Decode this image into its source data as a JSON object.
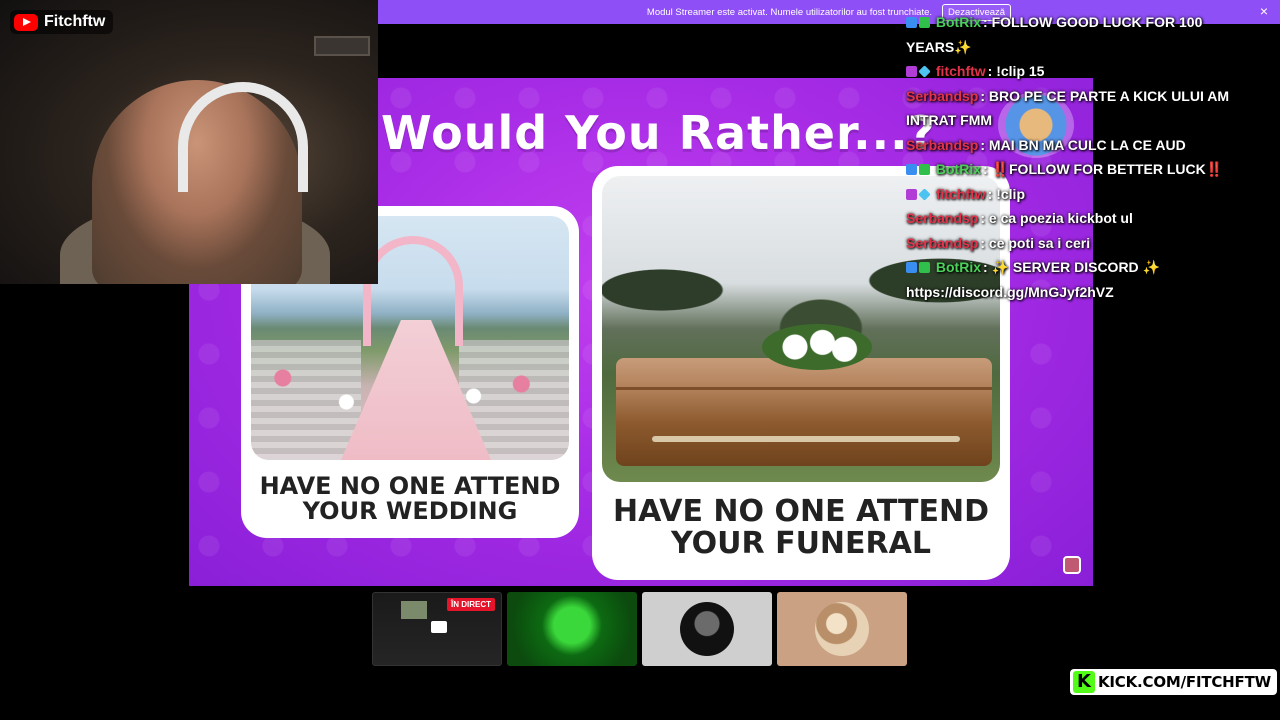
{
  "webcam": {
    "channel_name": "Fitchftw"
  },
  "banner": {
    "text": "Modul Streamer este activat. Numele utilizatorilor au fost trunchiate.",
    "button": "Dezactivează",
    "close": "×"
  },
  "quiz": {
    "title": "Would You Rather...?",
    "left_option": "HAVE NO ONE ATTEND YOUR WEDDING",
    "right_option": "HAVE NO ONE ATTEND YOUR FUNERAL"
  },
  "chat": {
    "messages": [
      {
        "user": "BotRix",
        "user_color": "#4bd15a",
        "text": "FOLLOW GOOD LUCK FOR 100 YEARS✨",
        "badges": [
          "bot-badge-icon",
          "verified-icon"
        ]
      },
      {
        "user": "fitchftw",
        "user_color": "#e3334a",
        "text": "!clip 15",
        "badges": [
          "mic-badge-icon",
          "cube-badge-icon"
        ]
      },
      {
        "user": "Serbandsp",
        "user_color": "#e3334a",
        "text": "BRO PE CE PARTE A KICK ULUI AM INTRAT FMM",
        "badges": []
      },
      {
        "user": "Serbandsp",
        "user_color": "#e3334a",
        "text": "MAI BN MA CULC LA CE AUD",
        "badges": []
      },
      {
        "user": "BotRix",
        "user_color": "#4bd15a",
        "text": "‼️FOLLOW FOR BETTER LUCK‼️",
        "badges": [
          "bot-badge-icon",
          "verified-icon"
        ]
      },
      {
        "user": "fitchftw",
        "user_color": "#e3334a",
        "text": "!clip",
        "badges": [
          "mic-badge-icon",
          "cube-badge-icon"
        ]
      },
      {
        "user": "Serbandsp",
        "user_color": "#e3334a",
        "text": "e ca poezia kickbot ul",
        "badges": []
      },
      {
        "user": "Serbandsp",
        "user_color": "#e3334a",
        "text": "ce poti sa i ceri",
        "badges": []
      },
      {
        "user": "BotRix",
        "user_color": "#4bd15a",
        "text": "✨ SERVER DISCORD ✨ https://discord.gg/MnGJyf2hVZ",
        "badges": [
          "bot-badge-icon",
          "verified-icon"
        ]
      }
    ]
  },
  "thumbnails": {
    "live_badge": "ÎN DIRECT",
    "items": [
      "screen-share-thumbnail",
      "green-scene-thumbnail",
      "avatar-thumbnail",
      "couple-thumbnail"
    ]
  },
  "watermark": {
    "k": "K",
    "text": "KICK.COM/FITCHFTW"
  },
  "colors": {
    "banner": "#8f4ff6",
    "kick_green": "#53fc18",
    "youtube_red": "#ff0000",
    "live_red": "#e5142b"
  }
}
